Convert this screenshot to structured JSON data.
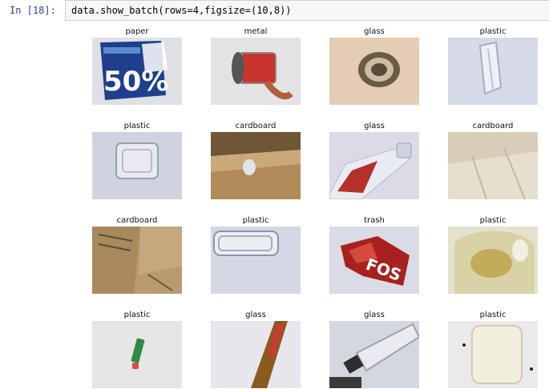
{
  "cell": {
    "prompt": "In [18]:",
    "code": "data.show_batch(rows=4,figsize=(10,8))"
  },
  "batch": {
    "labels": [
      "paper",
      "metal",
      "glass",
      "plastic",
      "plastic",
      "cardboard",
      "glass",
      "cardboard",
      "cardboard",
      "plastic",
      "trash",
      "plastic",
      "plastic",
      "glass",
      "glass",
      "plastic"
    ],
    "photo_text": {
      "paper_print": "50%",
      "trash_print": "FOS"
    }
  }
}
